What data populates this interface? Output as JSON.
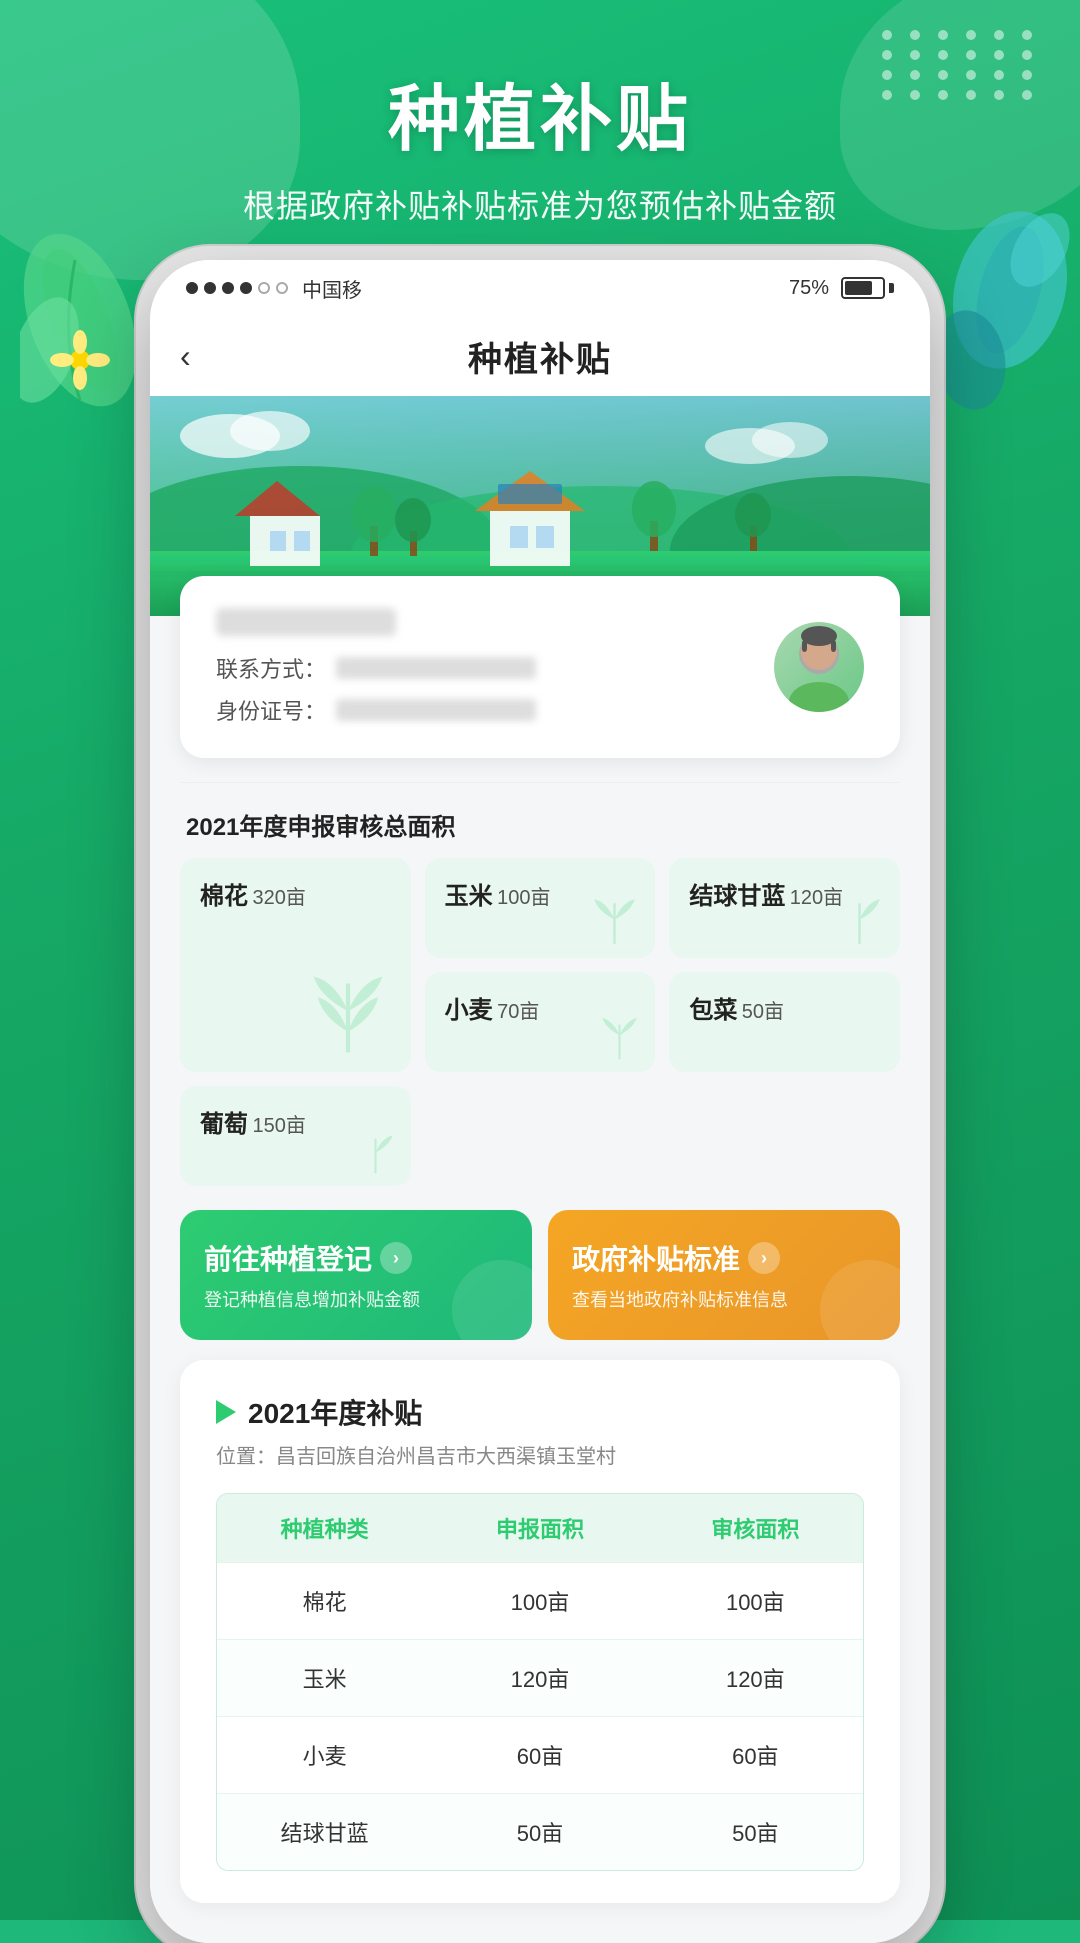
{
  "header": {
    "main_title": "种植补贴",
    "sub_title": "根据政府补贴补贴标准为您预估补贴金额"
  },
  "status_bar": {
    "carrier": "中国移",
    "battery_percent": "75%",
    "signal_dots": [
      true,
      true,
      true,
      true,
      false,
      false
    ]
  },
  "nav": {
    "back_label": "‹",
    "title": "种植补贴"
  },
  "user_card": {
    "contact_label": "联系方式：",
    "id_label": "身份证号："
  },
  "crop_section": {
    "label": "2021年度申报审核总面积",
    "crops": [
      {
        "name": "棉花",
        "area": "320亩",
        "large": true
      },
      {
        "name": "玉米",
        "area": "100亩",
        "large": false
      },
      {
        "name": "结球甘蓝",
        "area": "120亩",
        "large": false
      },
      {
        "name": "小麦",
        "area": "70亩",
        "large": false
      },
      {
        "name": "包菜",
        "area": "50亩",
        "large": false
      },
      {
        "name": "葡萄",
        "area": "150亩",
        "large": false
      }
    ]
  },
  "actions": {
    "register": {
      "title": "前往种植登记",
      "arrow": "›",
      "desc": "登记种植信息增加补贴金额"
    },
    "standard": {
      "title": "政府补贴标准",
      "arrow": "›",
      "desc": "查看当地政府补贴标准信息"
    }
  },
  "subsidy": {
    "title": "2021年度补贴",
    "location_label": "位置：",
    "location": "昌吉回族自治州昌吉市大西渠镇玉堂村",
    "table": {
      "headers": [
        "种植种类",
        "申报面积",
        "审核面积"
      ],
      "rows": [
        [
          "棉花",
          "100亩",
          "100亩"
        ],
        [
          "玉米",
          "120亩",
          "120亩"
        ],
        [
          "小麦",
          "60亩",
          "60亩"
        ],
        [
          "结球甘蓝",
          "50亩",
          "50亩"
        ]
      ]
    }
  }
}
